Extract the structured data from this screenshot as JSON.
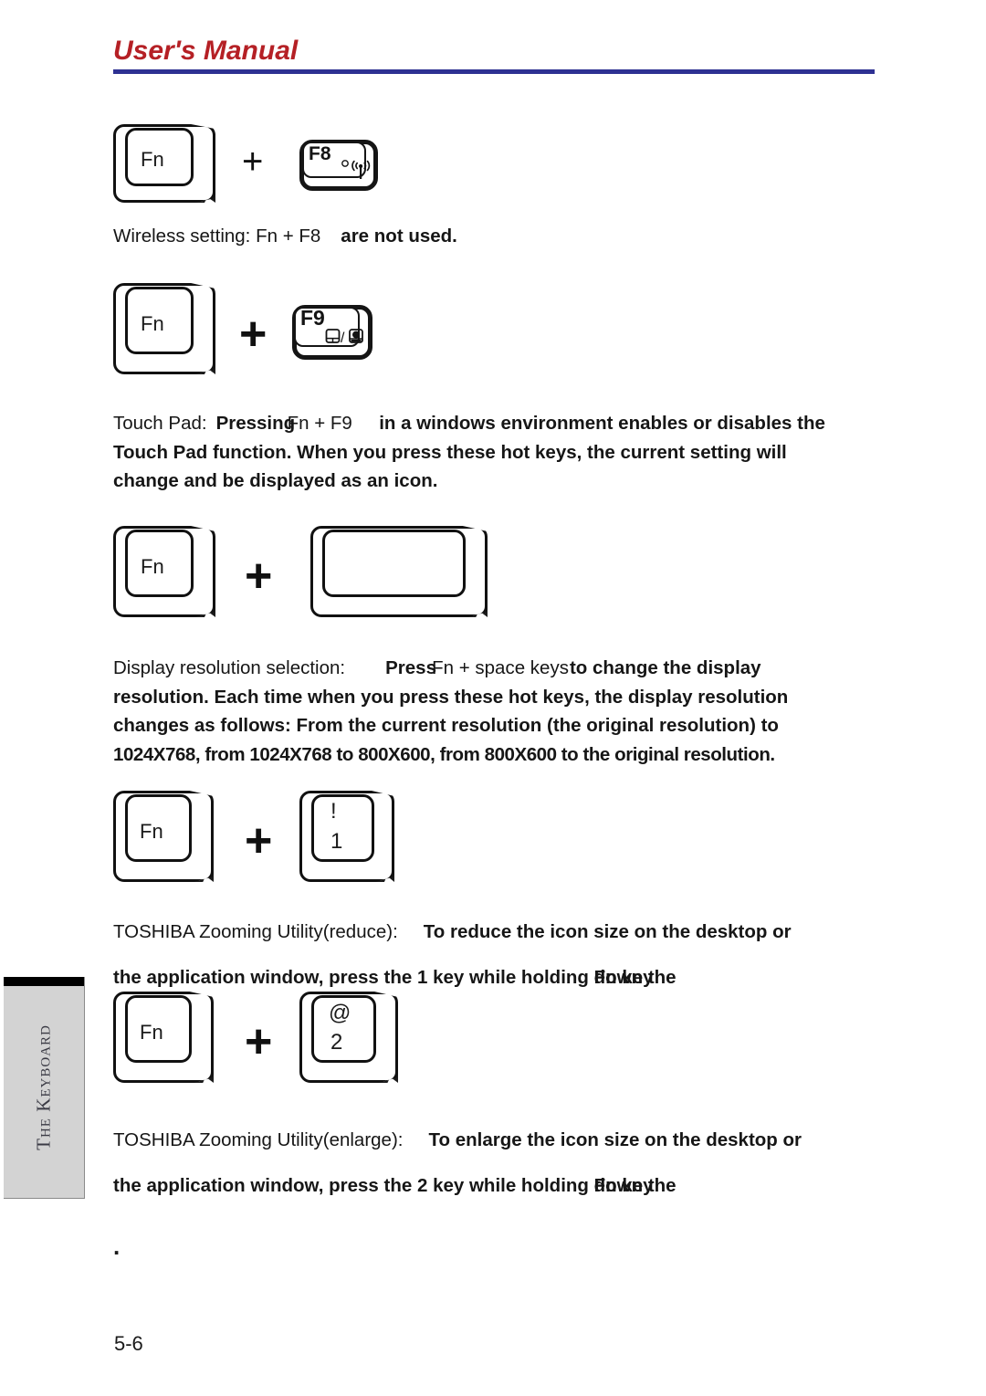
{
  "header": {
    "title": "User's Manual",
    "rule_color": "#2e3192",
    "title_color": "#b52025"
  },
  "side_tab": {
    "label": "The Keyboard"
  },
  "keys": {
    "fn_label": "Fn",
    "f8_label": "F8",
    "f9_label": "F9",
    "one_top": "!",
    "one_bottom": "1",
    "two_top": "@",
    "two_bottom": "2",
    "space_label": "",
    "plus": "+"
  },
  "icons": {
    "f8_icon": "wireless-antenna-icon",
    "f8_dot": "small-circle-icon",
    "f9_icon": "touchpad-mouse-icon"
  },
  "sections": {
    "wireless": {
      "lead": "Wireless setting: Fn + F8",
      "bold": "are not used."
    },
    "touchpad": {
      "lead": "Touch Pad:",
      "bold_1": "Pressing",
      "overlap_reg": "Fn + F9",
      "bold_2": "in a windows environment enables or disables the",
      "line_2": "Touch Pad function. When you press these hot keys, the  current setting will",
      "line_3": "change and be displayed as an icon."
    },
    "resolution": {
      "lead": "Display resolution selection:",
      "bold_1": "Press",
      "overlap_reg": "Fn + space keys",
      "bold_2": "to change the display",
      "line_2": "resolution. Each time when you press these hot keys, the display resolution",
      "line_3": "changes as follows: From the current resolution (the original resolution) to",
      "line_4": "1024X768, from 1024X768 to 800X600, from 800X600 to the original resolution."
    },
    "zoom_reduce": {
      "lead": "TOSHIBA Zooming Utility(reduce):",
      "bold_1": "To reduce the icon size on the desktop or",
      "line_2_a": "the application window, press the 1 key while holding ",
      "line_2_over_a": "down the",
      "line_2_over_b": "Fn key"
    },
    "zoom_enlarge": {
      "lead": "TOSHIBA Zooming Utility(enlarge):",
      "bold_1": "To enlarge the icon size on the desktop or",
      "line_2_a": "the application window, press the 2 key while holding ",
      "line_2_over_a": "down the",
      "line_2_over_b": "Fn key"
    }
  },
  "footer": {
    "page_number": "5-6",
    "stray_mark": "."
  }
}
